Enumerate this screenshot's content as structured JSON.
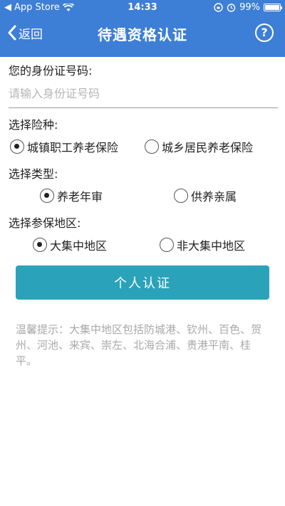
{
  "status_bar": {
    "carrier": "App Store",
    "time": "14:33",
    "battery": "99%",
    "battery_level": 0.99
  },
  "nav": {
    "back_label": "返回",
    "title": "待遇资格认证",
    "help_label": "?"
  },
  "form": {
    "id_label": "您的身份证号码:",
    "id_value": "",
    "id_placeholder": "请输入身份证号码",
    "insurance": {
      "label": "选择险种:",
      "options": [
        {
          "label": "城镇职工养老保险",
          "checked": true
        },
        {
          "label": "城乡居民养老保险",
          "checked": false
        }
      ]
    },
    "type": {
      "label": "选择类型:",
      "options": [
        {
          "label": "养老年审",
          "checked": true
        },
        {
          "label": "供养亲属",
          "checked": false
        }
      ]
    },
    "region": {
      "label": "选择参保地区:",
      "options": [
        {
          "label": "大集中地区",
          "checked": true
        },
        {
          "label": "非大集中地区",
          "checked": false
        }
      ]
    },
    "submit_label": "个人认证"
  },
  "tip": "温馨提示：大集中地区包括防城港、钦州、百色、贺州、河池、来宾、崇左、北海合浦、贵港平南、桂平。",
  "colors": {
    "header": "#3d7fd6",
    "button": "#2aa3ba",
    "tip_text": "#a8a8a8"
  }
}
